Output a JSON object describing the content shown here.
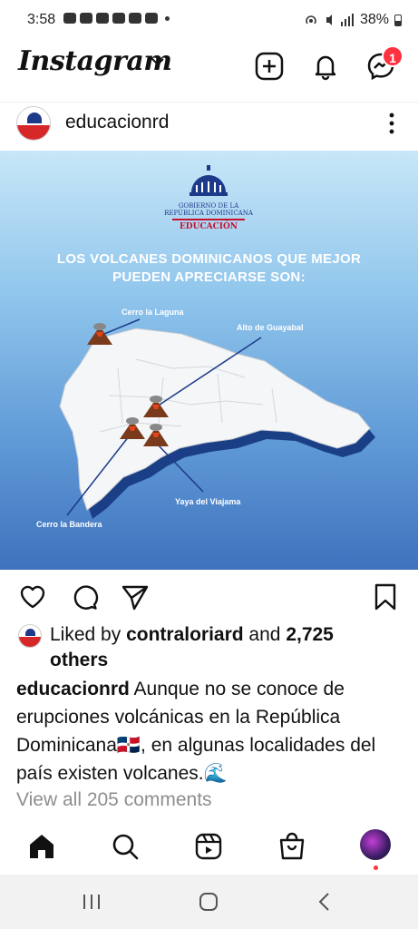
{
  "status_bar": {
    "time": "3:58",
    "battery": "38%"
  },
  "header": {
    "app_name": "Instagram",
    "notification_count": "1"
  },
  "post": {
    "username": "educacionrd",
    "image": {
      "gov_line1": "GOBIERNO DE LA",
      "gov_line2": "REPÚBLICA DOMINICANA",
      "gov_edu": "EDUCACIÓN",
      "headline_line1": "LOS VOLCANES DOMINICANOS QUE MEJOR",
      "headline_line2": "PUEDEN APRECIARSE SON:",
      "labels": {
        "cerro_laguna": "Cerro la Laguna",
        "alto_guayabal": "Alto de Guayabal",
        "yaya_viajama": "Yaya del Viajama",
        "cerro_bandera": "Cerro la Bandera"
      }
    },
    "likes": {
      "prefix": "Liked by ",
      "user": "contraloriard",
      "middle": " and ",
      "count": "2,725",
      "suffix": " others"
    },
    "caption": {
      "user": "educacionrd",
      "text": " Aunque no se conoce de erupciones volcánicas en la República Dominicana🇩🇴, en algunas localidades del país existen volcanes.🌊"
    },
    "comments_link": "View all 205 comments"
  },
  "colors": {
    "accent_red": "#ff3040",
    "muted_text": "#8e8e8e",
    "gov_blue": "#1d3a8a"
  }
}
